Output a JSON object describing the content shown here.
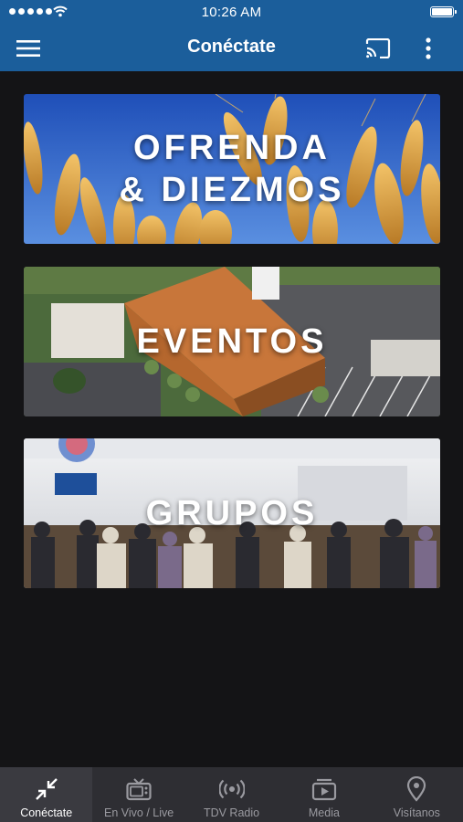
{
  "status_bar": {
    "time": "10:26 AM"
  },
  "app_bar": {
    "title": "Conéctate"
  },
  "cards": [
    {
      "title": "OFRENDA\n& DIEZMOS"
    },
    {
      "title": "EVENTOS"
    },
    {
      "title": "GRUPOS"
    }
  ],
  "bottom_nav": [
    {
      "label": "Conéctate",
      "icon": "arrows-inward-icon",
      "active": true
    },
    {
      "label": "En Vivo / Live",
      "icon": "tv-icon",
      "active": false
    },
    {
      "label": "TDV Radio",
      "icon": "radio-broadcast-icon",
      "active": false
    },
    {
      "label": "Media",
      "icon": "media-player-icon",
      "active": false
    },
    {
      "label": "Visítanos",
      "icon": "location-pin-icon",
      "active": false
    }
  ],
  "colors": {
    "app_bar": "#1b5e9b",
    "background": "#141416",
    "nav_bar": "#2e2e33",
    "nav_inactive": "#9a9aa0"
  }
}
